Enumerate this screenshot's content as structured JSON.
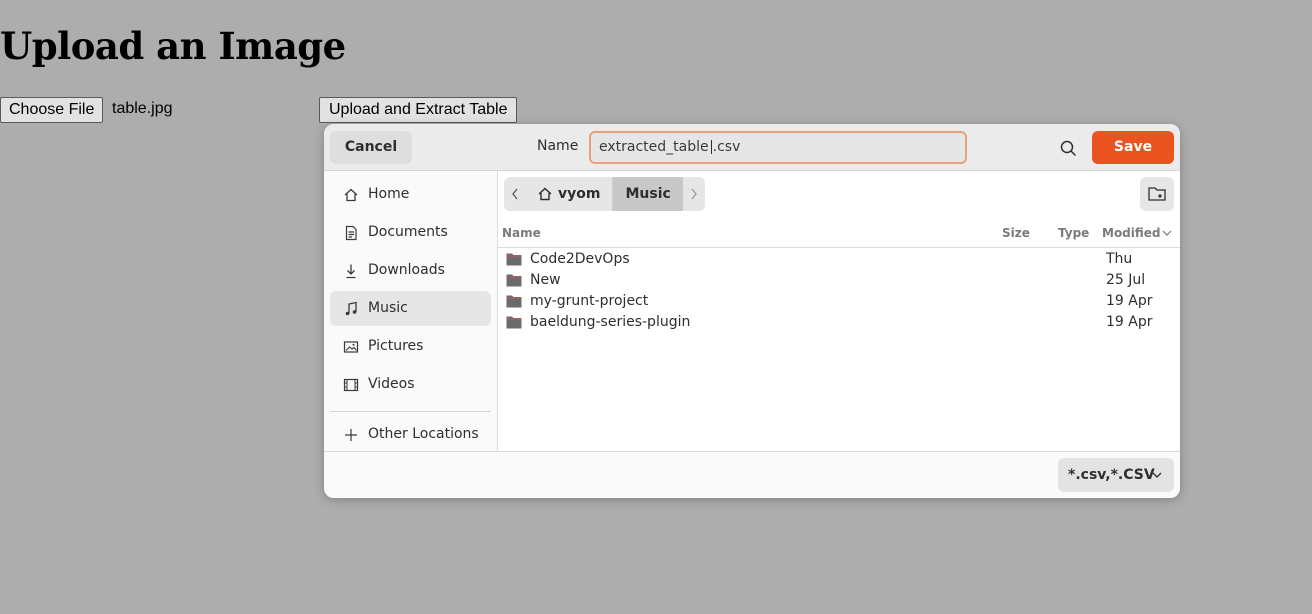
{
  "page": {
    "title": "Upload an Image",
    "choose_file_label": "Choose File",
    "selected_file": "table.jpg",
    "upload_label": "Upload and Extract Table"
  },
  "dialog": {
    "cancel_label": "Cancel",
    "name_label": "Name",
    "filename_before_caret": "extracted_table",
    "filename_after_caret": ".csv",
    "save_label": "Save",
    "accent_color": "#e95420",
    "sidebar": {
      "items": [
        {
          "label": "Home",
          "icon": "home-icon"
        },
        {
          "label": "Documents",
          "icon": "document-icon"
        },
        {
          "label": "Downloads",
          "icon": "download-icon"
        },
        {
          "label": "Music",
          "icon": "music-icon",
          "active": true
        },
        {
          "label": "Pictures",
          "icon": "picture-icon"
        },
        {
          "label": "Videos",
          "icon": "video-icon"
        }
      ],
      "other_locations": "Other Locations"
    },
    "path": {
      "home": "vyom",
      "current": "Music"
    },
    "columns": {
      "name": "Name",
      "size": "Size",
      "type": "Type",
      "modified": "Modified"
    },
    "files": [
      {
        "name": "Code2DevOps",
        "modified": "Thu"
      },
      {
        "name": "New",
        "modified": "25 Jul"
      },
      {
        "name": "my-grunt-project",
        "modified": "19 Apr"
      },
      {
        "name": "baeldung-series-plugin",
        "modified": "19 Apr"
      }
    ],
    "filter": "*.csv,*.CSV"
  }
}
